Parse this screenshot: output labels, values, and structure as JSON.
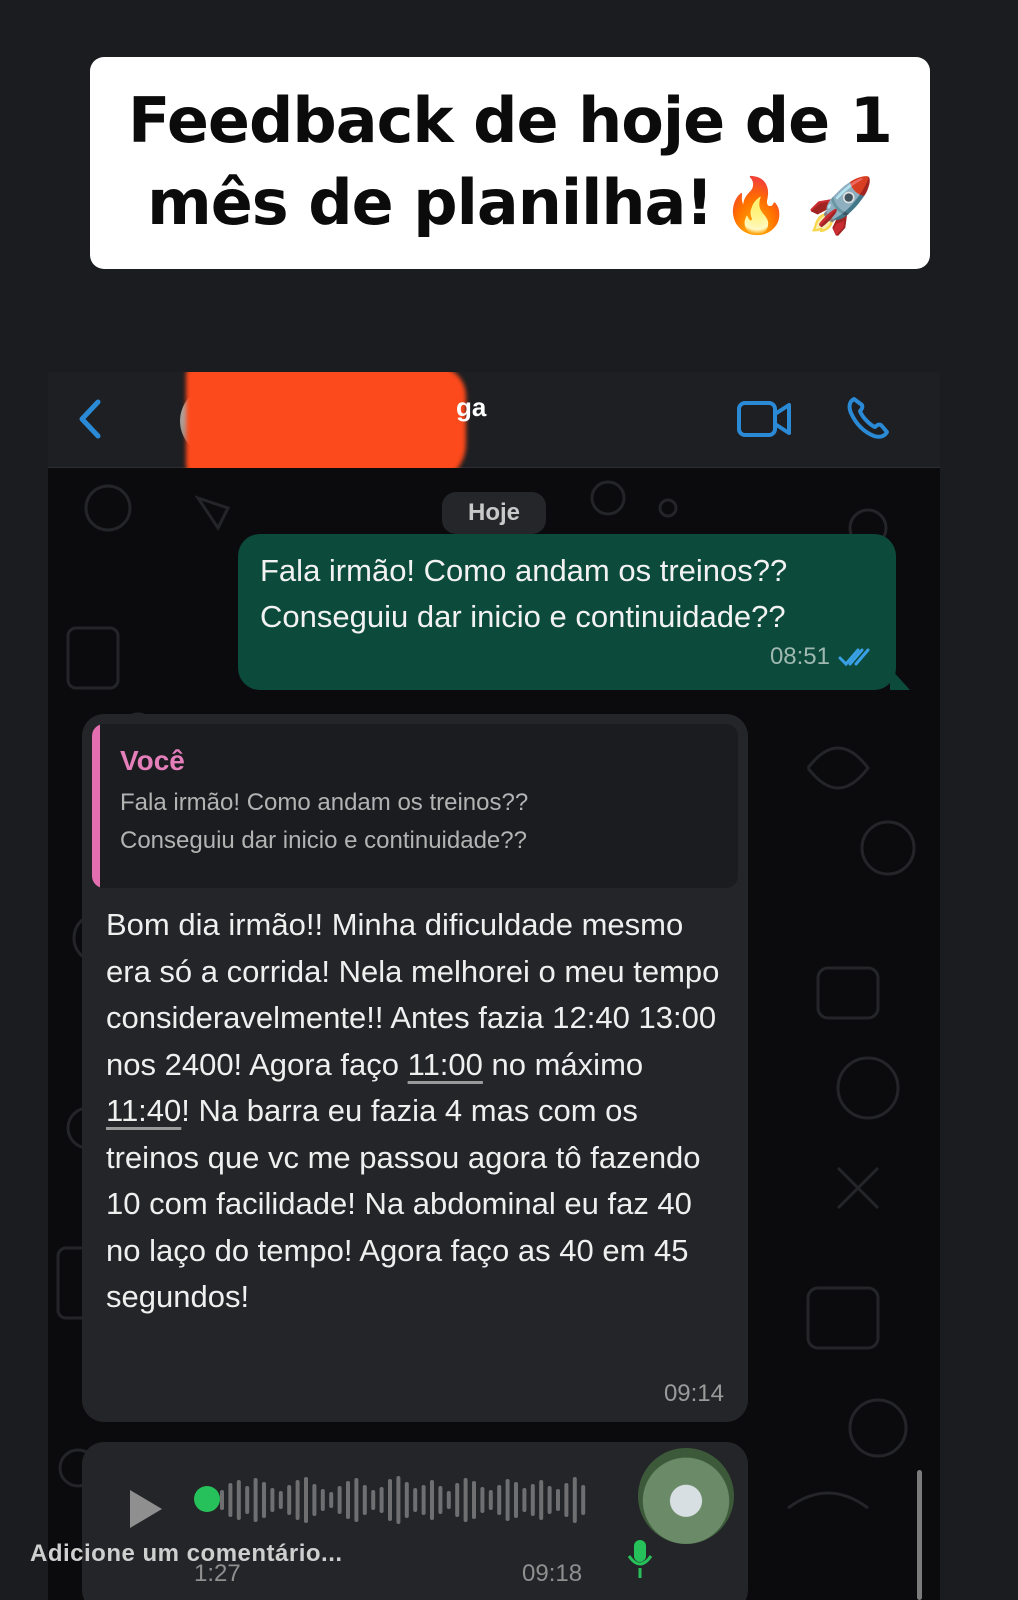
{
  "caption": {
    "line1": "Feedback de hoje de 1",
    "line2": "mês de planilha!",
    "emojis": "🔥 🚀"
  },
  "header": {
    "contact_name_visible": "ga",
    "back_icon": "chevron-left-icon",
    "video_icon": "video-camera-icon",
    "call_icon": "phone-icon",
    "accent_color": "#2a8ad6"
  },
  "chat": {
    "date_label": "Hoje",
    "outgoing": {
      "line1": "Fala irmão! Como andam os treinos??",
      "line2": "Conseguiu dar inicio e continuidade??",
      "time": "08:51",
      "status_icon": "double-check-icon"
    },
    "incoming": {
      "quote_author": "Você",
      "quote_line1": "Fala irmão! Como andam os treinos??",
      "quote_line2": "Conseguiu dar inicio e continuidade??",
      "text_part1": "Bom dia irmão!! Minha dificuldade mesmo era só a corrida! Nela melhorei o meu tempo consideravelmente!! Antes fazia 12:40 13:00 nos 2400! Agora faço ",
      "text_link1": "11:00",
      "text_part2": " no máximo ",
      "text_link2": "11:40",
      "text_part3": "! Na barra eu fazia 4 mas com os treinos que vc me passou agora tô fazendo 10 com facilidade! Na abdominal eu faz 40 no laço do tempo! Agora faço as 40 em 45 segundos!",
      "time": "09:14"
    },
    "voice": {
      "duration": "1:27",
      "time": "09:18",
      "play_icon": "play-icon",
      "mic_icon": "microphone-icon"
    }
  },
  "comment_placeholder": "Adicione um comentário..."
}
